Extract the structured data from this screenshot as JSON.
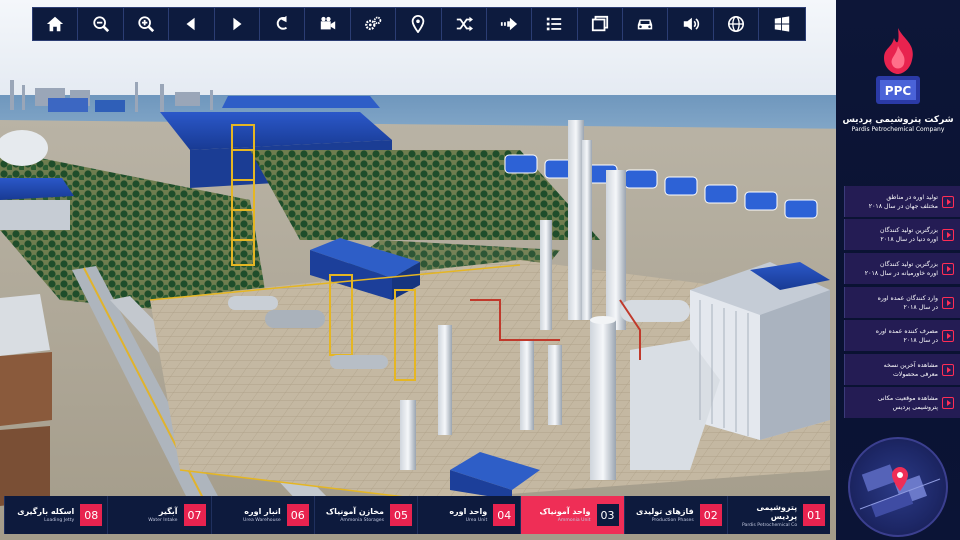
{
  "toolbar": {
    "icons": [
      "home-icon",
      "zoom-out-icon",
      "zoom-in-icon",
      "previous-icon",
      "next-icon",
      "rotate-icon",
      "camera-icon",
      "settings-gears-icon",
      "location-pin-icon",
      "shuffle-icon",
      "fast-forward-icon",
      "list-icon",
      "pages-icon",
      "car-icon",
      "volume-icon",
      "globe-icon",
      "windows-icon"
    ]
  },
  "company": {
    "logo_text": "PPC",
    "name_fa": "شرکت پتروشیمی پردیس",
    "name_en": "Pardis Petrochemical Company"
  },
  "info_buttons": [
    {
      "line1": "تولید اوره در مناطق",
      "line2": "مختلف جهان در سال ۲۰۱۸"
    },
    {
      "line1": "بزرگترین تولید کنندگان",
      "line2": "اوره دنیا در سال ۲۰۱۸"
    },
    {
      "line1": "بزرگترین تولید کنندگان",
      "line2": "اوره خاورمیانه در سال ۲۰۱۸"
    },
    {
      "line1": "وارد کنندگان عمده اوره",
      "line2": "در سال ۲۰۱۸"
    },
    {
      "line1": "مصرف کننده عمده اوره",
      "line2": "در سال ۲۰۱۸"
    },
    {
      "line1": "مشاهده آخرین نسخه",
      "line2": "معرفی محصولات"
    },
    {
      "line1": "مشاهده موقعیت مکانی",
      "line2": "پتروشیمی پردیس"
    }
  ],
  "bottom_nav": [
    {
      "num": "01",
      "fa": "پتروشیمی پردیس",
      "en": "Pardis Petrochemical Co"
    },
    {
      "num": "02",
      "fa": "فازهای تولیدی",
      "en": "Production Phases"
    },
    {
      "num": "03",
      "fa": "واحد آمونیاک",
      "en": "Ammonia Unit"
    },
    {
      "num": "04",
      "fa": "واحد اوره",
      "en": "Urea Unit"
    },
    {
      "num": "05",
      "fa": "مخازن آمونیاک",
      "en": "Ammonia Storages"
    },
    {
      "num": "06",
      "fa": "انبار اوره",
      "en": "Urea Warehouse"
    },
    {
      "num": "07",
      "fa": "آبگیر",
      "en": "Water Intake"
    },
    {
      "num": "08",
      "fa": "اسکله بارگیری",
      "en": "Loading Jetty"
    }
  ],
  "active_nav_index": 2,
  "colors": {
    "accent": "#ef2e56",
    "panel": "#0d1a3d",
    "info_button": "#241c54"
  }
}
